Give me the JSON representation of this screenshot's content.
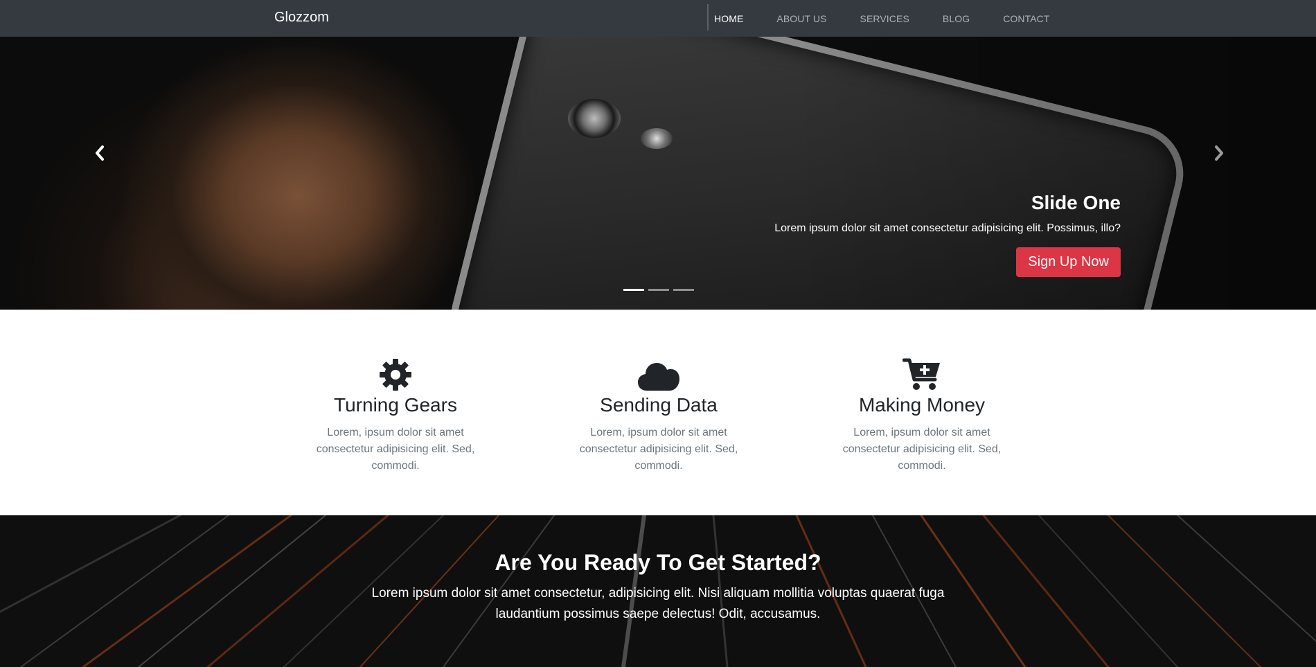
{
  "navbar": {
    "brand": "Glozzom",
    "links": [
      {
        "label": "HOME",
        "active": true
      },
      {
        "label": "ABOUT US",
        "active": false
      },
      {
        "label": "SERVICES",
        "active": false
      },
      {
        "label": "BLOG",
        "active": false
      },
      {
        "label": "CONTACT",
        "active": false
      }
    ],
    "background_color": "#343a40"
  },
  "hero": {
    "slide_title": "Slide One",
    "slide_text": "Lorem ipsum dolor sit amet consectetur adipisicing elit. Possimus, illo?",
    "button_label": "Sign Up Now",
    "button_color": "#dc3545",
    "prev_icon": "chevron-left-icon",
    "next_icon": "chevron-right-icon",
    "slide_count": 3,
    "active_slide": 1
  },
  "features": [
    {
      "icon": "gear-icon",
      "title": "Turning Gears",
      "text": "Lorem, ipsum dolor sit amet consectetur adipisicing elit. Sed, commodi."
    },
    {
      "icon": "cloud-icon",
      "title": "Sending Data",
      "text": "Lorem, ipsum dolor sit amet consectetur adipisicing elit. Sed, commodi."
    },
    {
      "icon": "cart-plus-icon",
      "title": "Making Money",
      "text": "Lorem, ipsum dolor sit amet consectetur adipisicing elit. Sed, commodi."
    }
  ],
  "cta": {
    "title": "Are You Ready To Get Started?",
    "text": "Lorem ipsum dolor sit amet consectetur, adipisicing elit. Nisi aliquam mollitia voluptas quaerat fuga laudantium possimus saepe delectus! Odit, accusamus."
  }
}
